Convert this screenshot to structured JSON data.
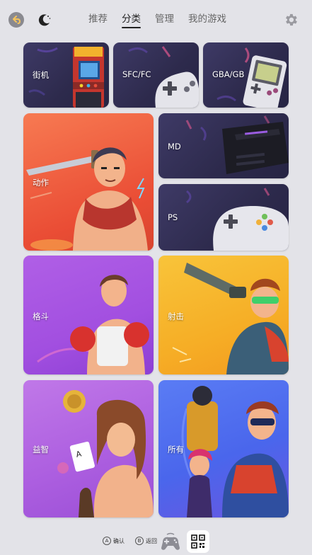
{
  "header": {
    "tabs": [
      {
        "label": "推荐",
        "active": false
      },
      {
        "label": "分类",
        "active": true
      },
      {
        "label": "管理",
        "active": false
      },
      {
        "label": "我的游戏",
        "active": false
      }
    ],
    "icons": {
      "back": "back-arrow-icon",
      "theme": "moon-icon",
      "settings": "gear-icon"
    }
  },
  "categories": {
    "arcade": "街机",
    "sfc": "SFC/FC",
    "gba": "GBA/GB",
    "action": "动作",
    "md": "MD",
    "ps": "PS",
    "fighting": "格斗",
    "shooting": "射击",
    "puzzle": "益智",
    "all": "所有"
  },
  "footer": {
    "confirm_key": "A",
    "confirm_label": "确认",
    "back_key": "B",
    "back_label": "返回",
    "icons": {
      "controller": "gamepad-icon",
      "qr": "qr-code-icon"
    }
  },
  "colors": {
    "background": "#e3e3e8",
    "dark_tile": "#35325a",
    "action": "#f0653f",
    "fighting": "#a050e0",
    "shooting": "#f7b52b",
    "puzzle": "#b26ae0",
    "all": "#4a6cf0"
  }
}
